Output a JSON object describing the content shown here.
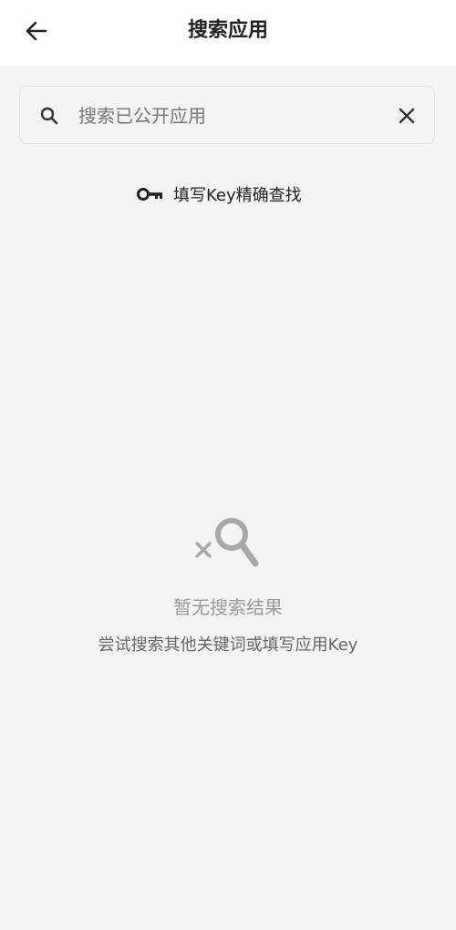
{
  "header": {
    "back_icon": "arrow-left-icon",
    "title": "搜索应用"
  },
  "search": {
    "icon": "search-icon",
    "placeholder": "搜索已公开应用",
    "value": "",
    "clear_icon": "close-icon"
  },
  "key_lookup": {
    "icon": "key-icon",
    "label": "填写Key精确查找"
  },
  "empty_state": {
    "icon": "search-no-results-icon",
    "title": "暂无搜索结果",
    "hint": "尝试搜索其他关键词或填写应用Key"
  },
  "colors": {
    "background": "#f4f4f4",
    "header_background": "#ffffff",
    "empty_icon": "#a8a8a8"
  }
}
